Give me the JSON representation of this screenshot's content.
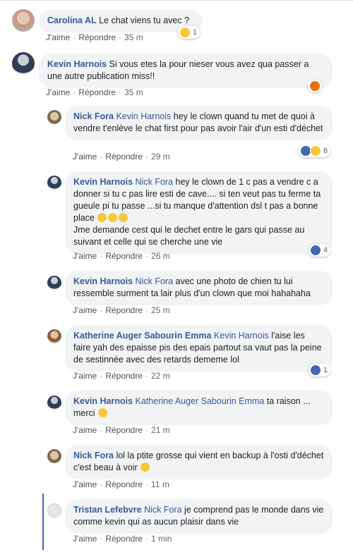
{
  "comments": [
    {
      "author": "Carolina AL",
      "tag": "",
      "text": "Le chat viens tu avec ?",
      "like": "J'aime",
      "reply": "Répondre",
      "time": "35 m",
      "reactions": [
        "haha"
      ],
      "count": "1"
    },
    {
      "author": "Kevin Harnois",
      "tag": "",
      "text": "Si vous etes la pour nieser vous avez qua passer a une autre publication miss!!",
      "like": "J'aime",
      "reply": "Répondre",
      "time": "35 m",
      "reactions": [
        "angry"
      ],
      "count": ""
    },
    {
      "author": "Nick Fora",
      "tag": "Kevin Harnois",
      "text": "hey le clown quand tu met de quoi à vendre t'enlève le chat first pour pas avoir l'air d'un esti d'déchet",
      "like": "J'aime",
      "reply": "Répondre",
      "time": "29 m",
      "reactions": [
        "like",
        "haha"
      ],
      "count": "6"
    },
    {
      "author": "Kevin Harnois",
      "tag": "Nick Fora",
      "text": "hey le clown de 1 c pas a vendre c a donner si tu c pas lire esti de cave.... si ten veut pas tu ferme ta gueule pi tu passe ...si tu manque d'attention dsl t pas a bonne place",
      "text2": "Jme demande cest qui le dechet entre le gars qui passe au suivant et celle qui se cherche une vie",
      "like": "J'aime",
      "reply": "Répondre",
      "time": "26 m",
      "reactions": [
        "like"
      ],
      "count": "4"
    },
    {
      "author": "Kevin Harnois",
      "tag": "Nick Fora",
      "text": "avec une photo de chien tu lui ressemble surment ta lair plus d'un clown que moi hahahaha",
      "like": "J'aime",
      "reply": "Répondre",
      "time": "25 m",
      "reactions": [],
      "count": ""
    },
    {
      "author": "Katherine Auger Sabourin Emma",
      "tag": "Kevin Harnois",
      "text": "l'aise les faire yah des epaisse pis des epais partout sa vaut pas la peine de sestinnée avec des retards dememe lol",
      "like": "J'aime",
      "reply": "Répondre",
      "time": "22 m",
      "reactions": [
        "like"
      ],
      "count": "1"
    },
    {
      "author": "Kevin Harnois",
      "tag": "Katherine Auger Sabourin Emma",
      "text": "ta raison ... merci",
      "like": "J'aime",
      "reply": "Répondre",
      "time": "21 m",
      "reactions": [],
      "count": ""
    },
    {
      "author": "Nick Fora",
      "tag": "",
      "text": "lol la ptite grosse qui vient en backup à l'osti d'déchet c'est beau à voir",
      "like": "J'aime",
      "reply": "Répondre",
      "time": "11 m",
      "reactions": [],
      "count": ""
    },
    {
      "author": "Tristan Lefebvre",
      "tag": "Nick Fora",
      "text": "je comprend pas le monde dans vie comme kevin qui as aucun plaisir dans vie",
      "like": "J'aime",
      "reply": "Répondre",
      "time": "1 min",
      "reactions": [],
      "count": ""
    }
  ],
  "emojis": {
    "rofl": "rolling-laughing-emoji",
    "smile": "smile-emoji"
  },
  "colors": {
    "link": "#385898",
    "bubble": "#f2f3f5",
    "like": "#4267b2",
    "haha": "#f7c93a",
    "angry": "#e9710f",
    "thread": "#4267b2"
  }
}
